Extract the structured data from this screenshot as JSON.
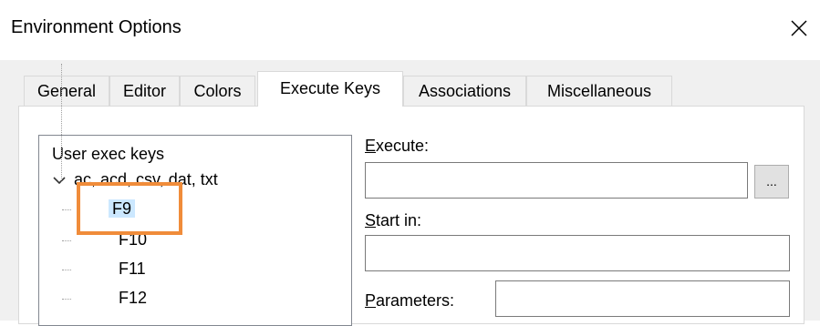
{
  "window": {
    "title": "Environment Options",
    "close_symbol": "✕"
  },
  "tabs": [
    {
      "label": "General",
      "active": false
    },
    {
      "label": "Editor",
      "active": false
    },
    {
      "label": "Colors",
      "active": false
    },
    {
      "label": "Execute Keys",
      "active": true
    },
    {
      "label": "Associations",
      "active": false
    },
    {
      "label": "Miscellaneous",
      "active": false
    }
  ],
  "tree": {
    "root_label": "User exec keys",
    "group_label": "ac, acd, csv, dat, txt",
    "items": [
      "F9",
      "F10",
      "F11",
      "F12"
    ],
    "selected": "F9"
  },
  "fields": {
    "execute": {
      "label_prefix": "",
      "accel": "E",
      "label_rest": "xecute:",
      "value": ""
    },
    "start_in": {
      "accel": "S",
      "label_rest": "tart in:",
      "value": ""
    },
    "parameters": {
      "accel": "P",
      "label_rest": "arameters:",
      "value": ""
    }
  },
  "browse_button": {
    "label": "..."
  },
  "colors": {
    "highlight": "#f08c3a",
    "selection": "#cce8ff"
  }
}
